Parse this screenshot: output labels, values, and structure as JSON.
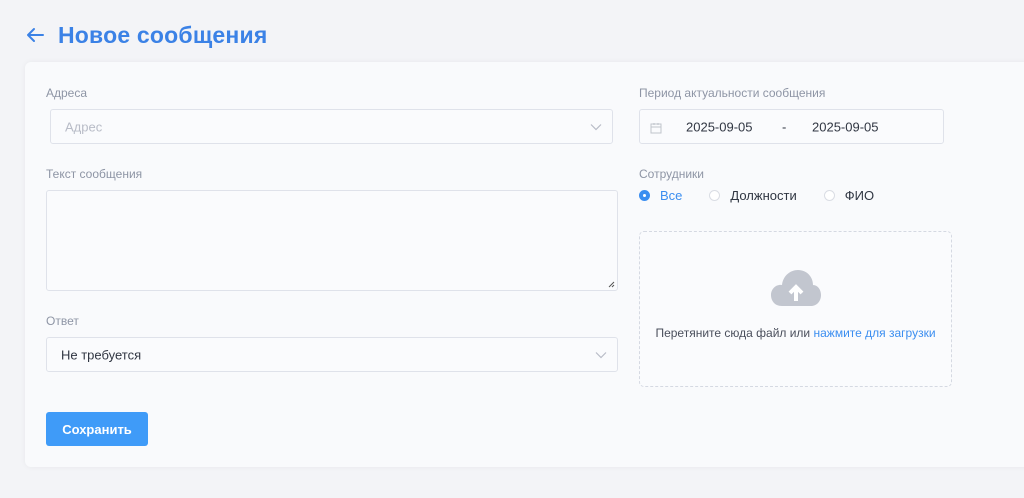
{
  "header": {
    "title": "Новое сообщения",
    "back_icon": "arrow-left-icon"
  },
  "form": {
    "address": {
      "label": "Адреса",
      "placeholder": "Адрес"
    },
    "message_text": {
      "label": "Текст сообщения",
      "value": ""
    },
    "reply": {
      "label": "Ответ",
      "value": "Не требуется"
    },
    "period": {
      "label": "Период актуальности сообщения",
      "start": "2025-09-05",
      "separator": "-",
      "end": "2025-09-05"
    },
    "employees": {
      "label": "Сотрудники",
      "options": [
        {
          "label": "Все",
          "checked": true
        },
        {
          "label": "Должности",
          "checked": false
        },
        {
          "label": "ФИО",
          "checked": false
        }
      ]
    },
    "upload": {
      "text": "Перетяните сюда файл или",
      "link": "нажмите для загрузки",
      "icon": "cloud-upload-icon"
    },
    "save_label": "Сохранить"
  },
  "colors": {
    "accent": "#3b8ef0",
    "title": "#3b82e6",
    "button": "#3f9bf8"
  }
}
